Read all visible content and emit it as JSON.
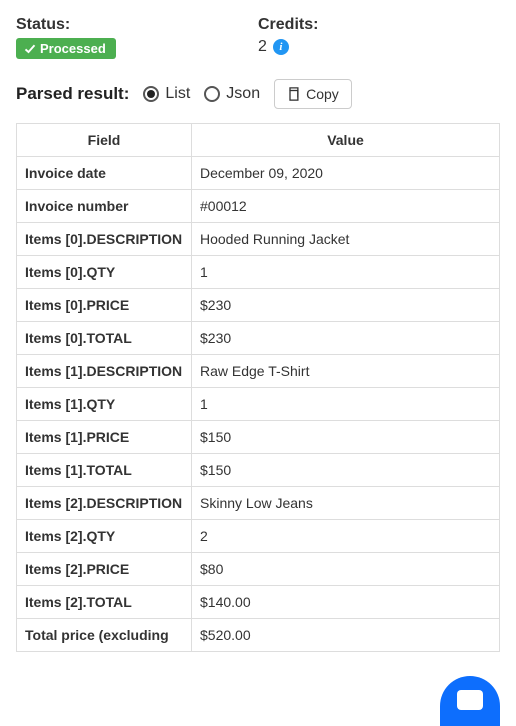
{
  "status": {
    "label": "Status:",
    "badge": "Processed"
  },
  "credits": {
    "label": "Credits:",
    "value": "2"
  },
  "parsed": {
    "label": "Parsed result:",
    "options": {
      "list": "List",
      "json": "Json"
    },
    "copy": "Copy"
  },
  "table": {
    "headers": {
      "field": "Field",
      "value": "Value"
    },
    "rows": [
      {
        "field": "Invoice date",
        "value": "December 09, 2020"
      },
      {
        "field": "Invoice number",
        "value": "#00012"
      },
      {
        "field": "Items [0].DESCRIPTION",
        "value": "Hooded Running Jacket"
      },
      {
        "field": "Items [0].QTY",
        "value": "1"
      },
      {
        "field": "Items [0].PRICE",
        "value": "$230"
      },
      {
        "field": "Items [0].TOTAL",
        "value": "$230"
      },
      {
        "field": "Items [1].DESCRIPTION",
        "value": "Raw Edge T-Shirt"
      },
      {
        "field": "Items [1].QTY",
        "value": "1"
      },
      {
        "field": "Items [1].PRICE",
        "value": "$150"
      },
      {
        "field": "Items [1].TOTAL",
        "value": "$150"
      },
      {
        "field": "Items [2].DESCRIPTION",
        "value": "Skinny Low Jeans"
      },
      {
        "field": "Items [2].QTY",
        "value": "2"
      },
      {
        "field": "Items [2].PRICE",
        "value": "$80"
      },
      {
        "field": "Items [2].TOTAL",
        "value": "$140.00"
      },
      {
        "field": "Total price (excluding",
        "value": "$520.00"
      }
    ]
  }
}
